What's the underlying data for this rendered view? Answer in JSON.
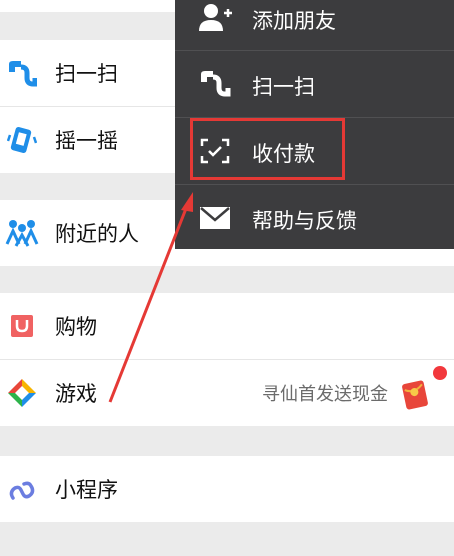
{
  "discover_list": {
    "scan": {
      "label": "扫一扫",
      "icon": "scan-icon"
    },
    "shake": {
      "label": "摇一摇",
      "icon": "shake-icon"
    },
    "nearby": {
      "label": "附近的人",
      "icon": "people-nearby-icon"
    },
    "shopping": {
      "label": "购物",
      "icon": "shopping-bag-icon"
    },
    "games": {
      "label": "游戏",
      "icon": "games-icon",
      "hint": "寻仙首发送现金",
      "badge_icon": "red-packet-icon"
    },
    "mini_programs": {
      "label": "小程序",
      "icon": "mini-program-icon"
    }
  },
  "popup_menu": {
    "items": [
      {
        "label": "添加朋友",
        "icon": "add-friend-icon"
      },
      {
        "label": "扫一扫",
        "icon": "scan-icon"
      },
      {
        "label": "收付款",
        "icon": "payment-code-icon"
      },
      {
        "label": "帮助与反馈",
        "icon": "mail-icon"
      }
    ]
  },
  "colors": {
    "menu_bg": "#3c3c3e",
    "annotation_red": "#e53935",
    "badge_red": "#f2383c"
  }
}
